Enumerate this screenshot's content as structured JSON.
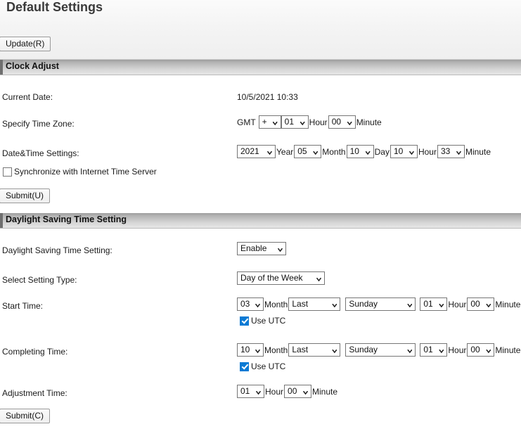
{
  "header": {
    "title": "Default Settings",
    "update_button": "Update(R)"
  },
  "clock_adjust": {
    "section_title": "Clock Adjust",
    "current_date": {
      "label": "Current Date:",
      "value": "10/5/2021 10:33"
    },
    "time_zone": {
      "label": "Specify Time Zone:",
      "gmt_prefix": "GMT",
      "sign": "+",
      "hour": "01",
      "hour_unit": "Hour",
      "minute": "00",
      "minute_unit": "Minute"
    },
    "date_time": {
      "label": "Date&Time Settings:",
      "year": "2021",
      "year_unit": "Year",
      "month": "05",
      "month_unit": "Month",
      "day": "10",
      "day_unit": "Day",
      "hour": "10",
      "hour_unit": "Hour",
      "minute": "33",
      "minute_unit": "Minute"
    },
    "sync": {
      "label": "Synchronize with Internet Time Server",
      "checked": false
    },
    "submit_button": "Submit(U)"
  },
  "daylight_saving": {
    "section_title": "Daylight Saving Time Setting",
    "enable": {
      "label": "Daylight Saving Time Setting:",
      "value": "Enable"
    },
    "setting_type": {
      "label": "Select Setting Type:",
      "value": "Day of the Week"
    },
    "start_time": {
      "label": "Start Time:",
      "month": "03",
      "month_unit": "Month",
      "ordinal": "Last",
      "weekday": "Sunday",
      "hour": "01",
      "hour_unit": "Hour",
      "minute": "00",
      "minute_unit": "Minute",
      "utc_label": "Use UTC",
      "utc_checked": true
    },
    "completing_time": {
      "label": "Completing Time:",
      "month": "10",
      "month_unit": "Month",
      "ordinal": "Last",
      "weekday": "Sunday",
      "hour": "01",
      "hour_unit": "Hour",
      "minute": "00",
      "minute_unit": "Minute",
      "utc_label": "Use UTC",
      "utc_checked": true
    },
    "adjustment_time": {
      "label": "Adjustment Time:",
      "hour": "01",
      "hour_unit": "Hour",
      "minute": "00",
      "minute_unit": "Minute"
    },
    "submit_button": "Submit(C)"
  }
}
